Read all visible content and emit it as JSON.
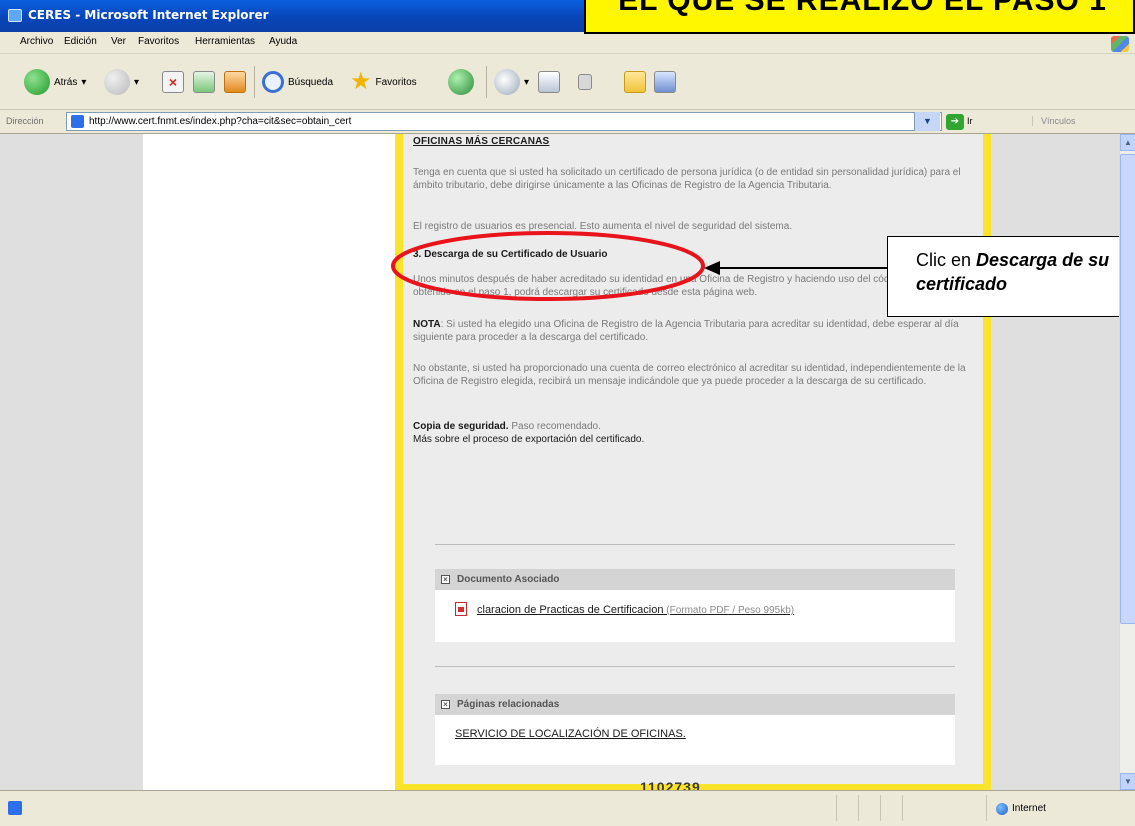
{
  "window": {
    "title": "CERES - Microsoft Internet Explorer"
  },
  "banner": {
    "text": "EL QUE SE REALIZO EL PASO 1"
  },
  "menu": [
    "Archivo",
    "Edición",
    "Ver",
    "Favoritos",
    "Herramientas",
    "Ayuda"
  ],
  "toolbar": {
    "back_label": "Atrás",
    "search_label": "Búsqueda",
    "favorites_label": "Favoritos"
  },
  "address": {
    "label": "Dirección",
    "url": "http://www.cert.fnmt.es/index.php?cha=cit&sec=obtain_cert",
    "go_label": "Ir",
    "links_label": "Vínculos"
  },
  "content": {
    "top_heading": "OFICINAS MÁS CERCANAS",
    "para1": "Tenga en cuenta que si usted ha solicitado un certificado de persona jurídica (o de entidad sin personalidad jurídica) para el ámbito tributario, debe dirigirse únicamente a las Oficinas de Registro de la Agencia Tributaria.",
    "para2": "El registro de usuarios es presencial. Esto aumenta el nivel de seguridad del sistema.",
    "step_heading": "3. Descarga de su Certificado de Usuario",
    "para3": "Unos minutos después de haber acreditado su identidad en una Oficina de Registro y haciendo uso del código de solicitud obtenido en el paso 1, podrá descargar su certificado desde esta página web.",
    "nota_label": "NOTA",
    "nota_text": ": Si usted ha elegido una Oficina de Registro de la Agencia Tributaria para acreditar su identidad, debe esperar al día siguiente para proceder a la descarga del certificado.",
    "para4": "No obstante, si usted ha proporcionado una cuenta de correo electrónico al acreditar su identidad, independientemente de la Oficina de Registro elegida, recibirá un mensaje indicándole que ya puede proceder a la descarga de su certificado.",
    "backup_label": "Copia de seguridad.",
    "backup_note": " Paso recomendado.",
    "export_link": "Más sobre el proceso de exportación del certificado."
  },
  "documento": {
    "header": "Documento Asociado",
    "link": "claracion de Practicas de Certificacion",
    "meta": " (Formato PDF / Peso 995kb)"
  },
  "relacionadas": {
    "header": "Páginas relacionadas",
    "link": "SERVICIO DE LOCALIZACIÓN DE OFICINAS."
  },
  "footer": {
    "number": "1102739"
  },
  "callout": {
    "prefix": "Clic en ",
    "bold1": "Descarga de su",
    "bold2": "certificado"
  },
  "status": {
    "zone": "Internet"
  },
  "colors": {
    "highlight_ellipse": "#e8131b",
    "banner": "#fff700",
    "page_border": "#fde32c"
  }
}
